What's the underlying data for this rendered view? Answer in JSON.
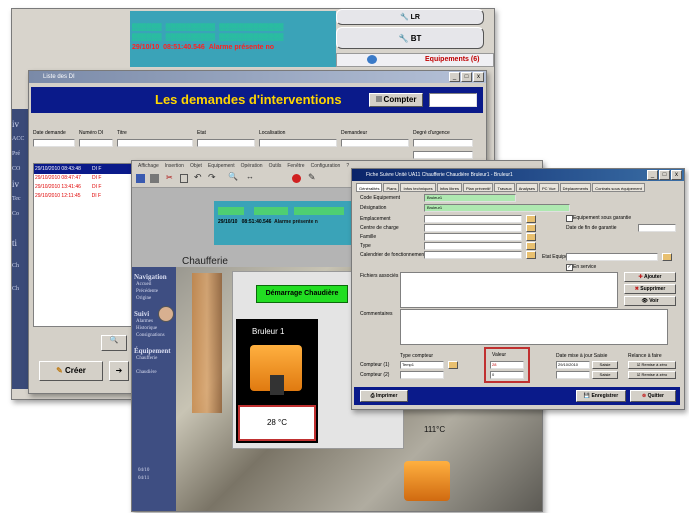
{
  "back_status": {
    "rows": [
      {
        "date": "▒▒▒▒▒▒",
        "time": "▒▒▒▒▒▒▒▒▒▒",
        "text": "▒▒▒▒▒▒▒▒▒▒▒▒▒",
        "color": "green"
      },
      {
        "date": "▒▒▒▒▒▒",
        "time": "▒▒▒▒▒▒▒▒▒▒",
        "text": "▒▒▒▒▒▒▒▒▒▒▒▒▒",
        "color": "green"
      },
      {
        "date": "29/10/10",
        "time": "08:51:40.546",
        "text": "Alarme présente no",
        "color": "red"
      }
    ]
  },
  "right_panel": {
    "lr_label": "LR",
    "bt_label": "BT",
    "equipements_label": "Equipements (6)"
  },
  "di_window": {
    "title": "Liste des DI",
    "heading": "Les demandes d'interventions",
    "compter_label": "Compter",
    "columns": [
      "Date demande",
      "Numéro DI",
      "Titre",
      "Etat",
      "Localisation",
      "Demandeur",
      "Degré d'urgence"
    ],
    "rows": [
      {
        "date": "29/10/2010 08:43:48",
        "title": "DI F",
        "selected": true
      },
      {
        "date": "29/10/2010 08:47:47",
        "title": "DI F",
        "selected": false
      },
      {
        "date": "29/10/2010 13:41:46",
        "title": "DI F",
        "selected": false
      },
      {
        "date": "29/10/2010 12:11:45",
        "title": "DI F",
        "selected": false
      }
    ],
    "creer_label": "Créer",
    "side_labels": [
      "iv",
      "ACC",
      "Pré",
      "CO",
      "iv",
      "Tec",
      "Co",
      "ti",
      "Ch",
      "Ch"
    ]
  },
  "chauff_window": {
    "menu": [
      "Affichage",
      "Insertion",
      "Objet",
      "Equipement",
      "Opération",
      "Outils",
      "Fenêtre",
      "Configuration",
      "?"
    ],
    "status": {
      "date": "29/10/10",
      "time": "08:51:40.546",
      "text": "Alarme présente n"
    },
    "section_title": "Chaufferie",
    "nav_sections": [
      {
        "title": "Navigation",
        "items": [
          "Accueil",
          "Précédente",
          "Origine"
        ]
      },
      {
        "title": "Suivi",
        "items": [
          "Alarmes",
          "Historique",
          "Consignations"
        ]
      },
      {
        "title": "Équipement",
        "items": [
          "Chaufferie",
          "",
          "Chaudière"
        ]
      }
    ],
    "bottom_numbers": [
      "04/10",
      "04/11"
    ],
    "start_button": "Démarrage Chaudière",
    "burner_label": "Bruleur 1",
    "temp1": "28 °C",
    "temp2": "111°C"
  },
  "fiche_window": {
    "title": "Fiche Suivre Unité UA11 Chaufferie Chaudière Bruleur1 - Bruleur1",
    "tabs": [
      "Généralités",
      "Plans",
      "Infos techniques",
      "Infos libres",
      "Plan préventif",
      "Travaux",
      "Analyses",
      "PC Vue",
      "Déplacements",
      "Contrats sous équipement"
    ],
    "labels": [
      "Code Equipement",
      "Désignation",
      "Emplacement",
      "Centre de charge",
      "Famille",
      "Type",
      "Calendrier de fonctionnement"
    ],
    "code_value": "Bruleur1",
    "designation_value": "Bruleur1",
    "garantie_label": "Equipement sous garantie",
    "date_garantie_label": "Date de fin de garantie",
    "etat_label": "Etat Equipe",
    "en_service_label": "En service",
    "fichiers_label": "Fichiers associés",
    "ajouter_label": "Ajouter",
    "supprimer_label": "Supprimer",
    "voir_label": "Voir",
    "comment_label": "Commentaires",
    "type_compteur_label": "Type compteur",
    "compteur1_label": "Compteur (1)",
    "compteur2_label": "Compteur (2)",
    "compteur1_value": "Temp1",
    "valeur_label": "Valeur",
    "valeur1": "28",
    "valeur2": "0",
    "date_saisie_label": "Date mise à jour Saisie",
    "date_saisie_value": "29/10/2010",
    "saisie_label": "Saisie",
    "relance_label": "Relance à faire",
    "remise1_label": "Remise à zéro",
    "remise2_label": "Remise à zéro",
    "imprimer_label": "Imprimer",
    "enregistrer_label": "Enregistrer",
    "quitter_label": "Quitter"
  }
}
